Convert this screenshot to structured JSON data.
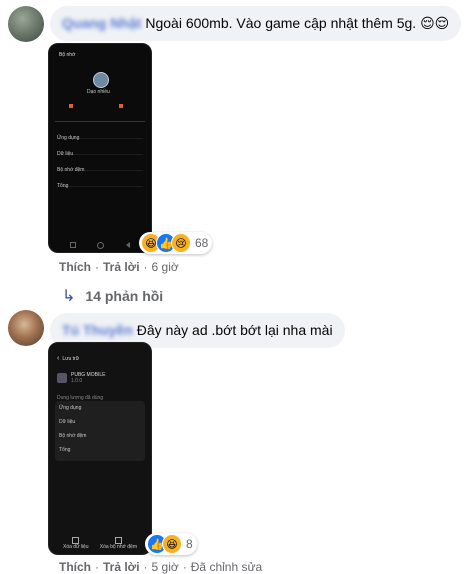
{
  "comments": [
    {
      "author": "Quang Nhật",
      "text": "Ngoài 600mb. Vào game cập nhật thêm 5g.",
      "emoji": "😌😌",
      "reactions": {
        "icons": [
          "haha-icon",
          "like-icon",
          "sad-icon"
        ],
        "count": "68"
      },
      "actions": {
        "like": "Thích",
        "reply": "Trả lời",
        "time": "6 giờ"
      },
      "screenshot": {
        "title": "Bộ nhớ",
        "subtitle": "Dạo nhiều",
        "rows": [
          "Ứng dụng",
          "Dữ liệu",
          "Bộ nhớ đệm",
          "Tổng"
        ],
        "values": [
          "",
          "",
          "",
          ""
        ]
      }
    },
    {
      "author": "Tú Thuyền",
      "text": "Đây này ad .bớt bớt lại nha mài",
      "reactions": {
        "icons": [
          "like-icon",
          "haha-icon"
        ],
        "count": "8"
      },
      "actions": {
        "like": "Thích",
        "reply": "Trả lời",
        "time": "5 giờ",
        "edited": "Đã chỉnh sửa"
      },
      "screenshot": {
        "back_label": "Lưu trữ",
        "app_name": "PUBG MOBILE",
        "app_version": "1.0.0",
        "section": "Dung lượng đã dùng",
        "rows": [
          "Ứng dụng",
          "Dữ liệu",
          "Bộ nhớ đệm",
          "Tổng"
        ],
        "values": [
          "",
          "",
          "",
          ""
        ],
        "bottom": [
          "Xóa dữ liệu",
          "Xóa bộ nhớ đệm"
        ]
      }
    }
  ],
  "replies": {
    "label": "14 phản hồi"
  },
  "colors": {
    "link": "#385898",
    "meta": "#65676b",
    "bubble": "#f0f2f5",
    "like": "#1877f2"
  }
}
